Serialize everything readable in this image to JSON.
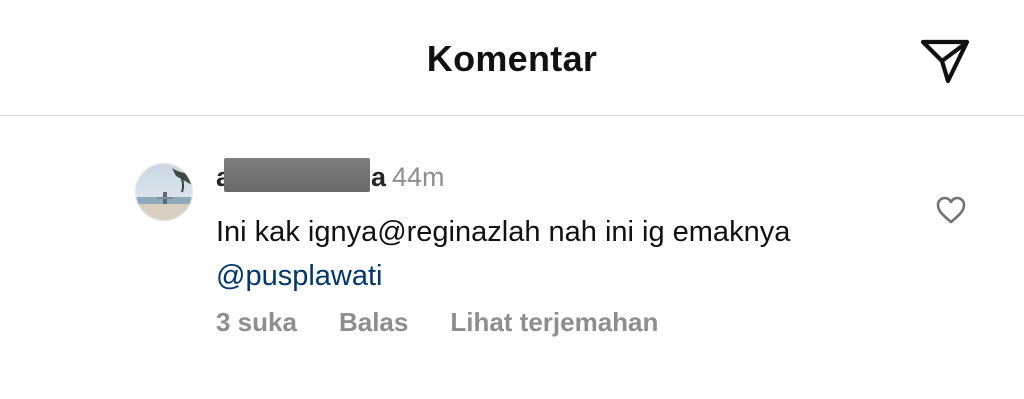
{
  "header": {
    "title": "Komentar",
    "share_icon": "paper-plane-icon"
  },
  "comment": {
    "username_first": "a",
    "username_last": "a",
    "time": "44m",
    "text_part1": "Ini kak ignya@reginazlah nah ini ig emaknya ",
    "mention": "@pusplawati",
    "actions": {
      "likes": "3 suka",
      "reply": "Balas",
      "translate": "Lihat terjemahan"
    },
    "like_icon": "heart-outline-icon"
  },
  "colors": {
    "text": "#111111",
    "secondary": "#8e8e8e",
    "mention": "#00376b",
    "divider": "#dbdbdb"
  }
}
